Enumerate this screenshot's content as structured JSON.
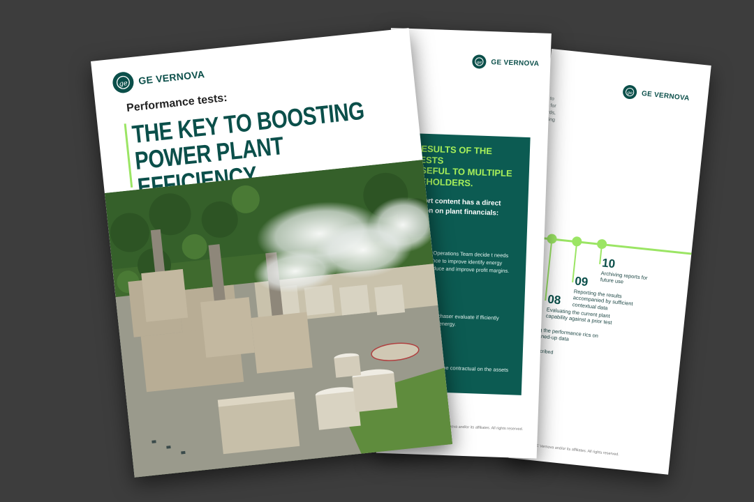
{
  "brand": {
    "name": "GE VERNOVA",
    "logo_glyph": "ge",
    "primary_color": "#0b4f4a",
    "accent_color": "#9be564"
  },
  "cover": {
    "kicker": "Performance tests:",
    "headline_line1": "THE KEY TO BOOSTING",
    "headline_line2": "POWER PLANT EFFICIENCY",
    "image": "power-plant-aerial-photo"
  },
  "middle_page": {
    "panel_heading_line1": "RESULTS OF THE TESTS",
    "panel_heading_line2": "USEFUL TO MULTIPLE",
    "panel_heading_line3": "KEHOLDERS.",
    "panel_subheading_line1": "report content has a direct",
    "panel_subheading_line2": "cation on plant financials:",
    "para1": "the Plant Operations Team decide t needs maintenance to improve identify energy losses, reduce and improve profit margins.",
    "para2": "e Power Purchaser evaluate if fficiently converted to energy.",
    "para3": "OEM decide if the contractual on the assets are met.",
    "footer": "© 2024 GE Vernova and/or its affiliates. All rights reserved."
  },
  "back_page": {
    "top_fragments": [
      "s to",
      "ls for",
      "ards,",
      "uring",
      "s"
    ],
    "steps": [
      {
        "number": "10",
        "text": "Archiving reports for future use"
      },
      {
        "number": "09",
        "text": "Reporting the results accompanied by sufficient contextual data"
      },
      {
        "number": "08",
        "text": "Evaluating the current plant capability against a prior test"
      },
      {
        "number": "7",
        "text": "mputing the performance rics on the cleaned-up data"
      }
    ],
    "lower_fragments": [
      "a as prescribed",
      "andards",
      "propriate"
    ],
    "footer": "© 2024 GE Vernova and/or its affiliates. All rights reserved."
  }
}
